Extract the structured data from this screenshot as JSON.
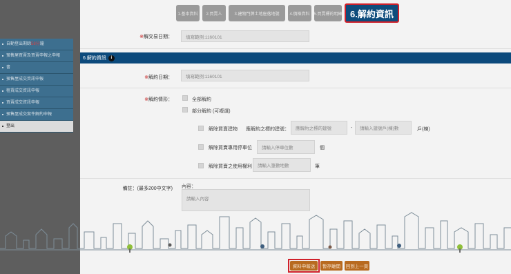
{
  "steps": [
    {
      "label": "1.基本資料",
      "active": false
    },
    {
      "label": "2.買賣人",
      "active": false
    },
    {
      "label": "3.建物門牌土地座落地號",
      "active": false
    },
    {
      "label": "4.價格資料",
      "active": false
    },
    {
      "label": "5.買賣標的明細",
      "active": false
    },
    {
      "label": "6.解約資訊",
      "active": true
    }
  ],
  "top_field": {
    "label": "解交易日期：",
    "placeholder": "填寫範例:1160101"
  },
  "section": {
    "title": "6.解約資訊",
    "info_icon": "i"
  },
  "cancel_date": {
    "label": "解約日期：",
    "placeholder": "填寫範例:1160101"
  },
  "cancel_status": {
    "label": "解約情形：",
    "option_full": "全部解約",
    "option_partial": "部分解約 (可複選)",
    "sub_1": {
      "label": "解除買賣建物",
      "middle": "應解約之標的建號：",
      "placeholder_1": "應解約之標的建號",
      "dash": "-",
      "placeholder_2": "請輸入建號戶(棟)數",
      "unit": "戶(棟)"
    },
    "sub_2": {
      "label": "解除買賣專用停車位",
      "placeholder": "請輸入停車位數",
      "unit": "個"
    },
    "sub_3": {
      "label": "解除買賣之使用權利",
      "placeholder": "請輸入筆數地數",
      "unit": "筆"
    }
  },
  "remark": {
    "label": "備註：(最多200中文字)",
    "sub_label": "內容：",
    "placeholder": "請輸入內容"
  },
  "sidebar": {
    "items": [
      {
        "pre": "自動登出剩餘",
        "highlight": "58分",
        "post": "鐘",
        "style": "dark"
      },
      {
        "pre": "預售屋買賣及買賣申報之申報",
        "highlight": "",
        "post": "",
        "style": "dark"
      },
      {
        "pre": "書",
        "highlight": "",
        "post": "",
        "style": "dark"
      },
      {
        "pre": "預售屋成交資訊申報",
        "highlight": "",
        "post": "",
        "style": "dark"
      },
      {
        "pre": "租賃成交資訊申報",
        "highlight": "",
        "post": "",
        "style": "dark"
      },
      {
        "pre": "買賣成交資訊申報",
        "highlight": "",
        "post": "",
        "style": "dark"
      },
      {
        "pre": "預售屋成交案件解約申報",
        "highlight": "",
        "post": "",
        "style": "dark"
      },
      {
        "pre": "登出",
        "highlight": "",
        "post": "",
        "style": "light"
      }
    ]
  },
  "buttons": {
    "submit": "資料申報送",
    "temp": "暫存離開",
    "back": "回到上一頁"
  },
  "colors": {
    "primary": "#0e4c7c",
    "accent": "#b86a1f",
    "highlight_border": "#d0202a"
  }
}
